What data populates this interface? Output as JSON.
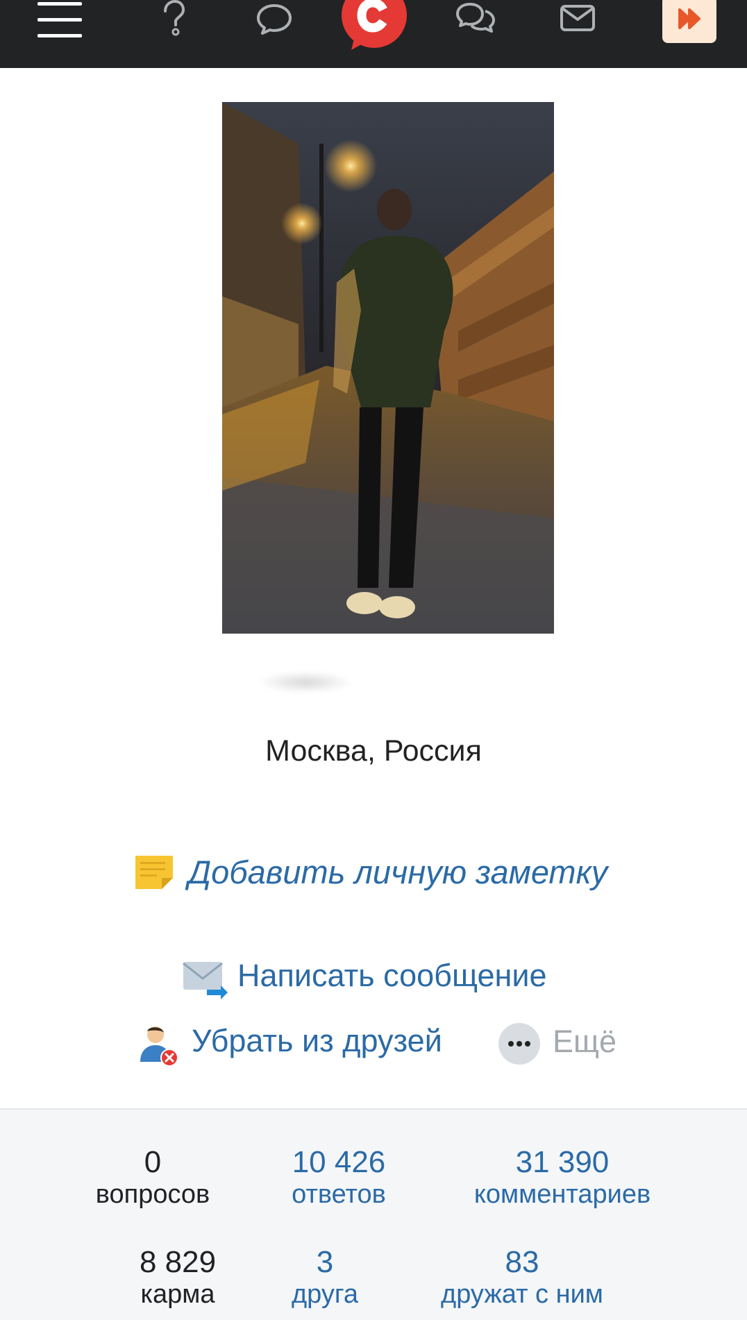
{
  "topbar": {
    "icons": [
      "menu-icon",
      "question-icon",
      "comment-icon",
      "site-logo",
      "dialogs-icon",
      "mail-icon",
      "fast-forward-icon"
    ],
    "accent_color": "#e53935"
  },
  "profile": {
    "location": "Москва, Россия"
  },
  "actions": {
    "add_note": "Добавить личную заметку",
    "send_message": "Написать сообщение",
    "remove_friend": "Убрать из друзей",
    "more": "Ещё"
  },
  "stats": {
    "questions": {
      "value": "0",
      "label": "вопросов"
    },
    "answers": {
      "value": "10 426",
      "label": "ответов"
    },
    "comments": {
      "value": "31 390",
      "label": "комментариев"
    },
    "karma": {
      "value": "8 829",
      "label": "карма"
    },
    "friends": {
      "value": "3",
      "label": "друга"
    },
    "friended_by": {
      "value": "83",
      "label": "дружат с ним"
    }
  },
  "colors": {
    "link": "#2b6aa6",
    "topbar": "#222324",
    "stats_bg": "#f4f6f8"
  }
}
